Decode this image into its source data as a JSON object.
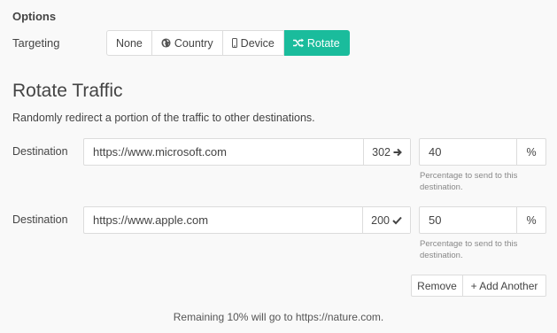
{
  "options": {
    "title": "Options",
    "targeting_label": "Targeting",
    "targeting_buttons": [
      {
        "label": "None",
        "icon": "",
        "active": false
      },
      {
        "label": "Country",
        "icon": "globe-icon",
        "active": false
      },
      {
        "label": "Device",
        "icon": "mobile-icon",
        "active": false
      },
      {
        "label": "Rotate",
        "icon": "shuffle-icon",
        "active": true
      }
    ]
  },
  "rotate": {
    "heading": "Rotate Traffic",
    "description": "Randomly redirect a portion of the traffic to other destinations.",
    "destinations": [
      {
        "label": "Destination",
        "url": "https://www.microsoft.com",
        "status": "302",
        "status_icon": "arrow-right-icon",
        "percentage": "40",
        "percent_sign": "%",
        "help": "Percentage to send to this destination."
      },
      {
        "label": "Destination",
        "url": "https://www.apple.com",
        "status": "200",
        "status_icon": "check-icon",
        "percentage": "50",
        "percent_sign": "%",
        "help": "Percentage to send to this destination."
      }
    ],
    "remove_label": "Remove",
    "add_label": "+ Add Another",
    "remaining_text": "Remaining 10% will go to https://nature.com."
  },
  "colors": {
    "accent": "#1abc9c",
    "background": "#f9f9f9",
    "border": "#dcdcdc"
  }
}
